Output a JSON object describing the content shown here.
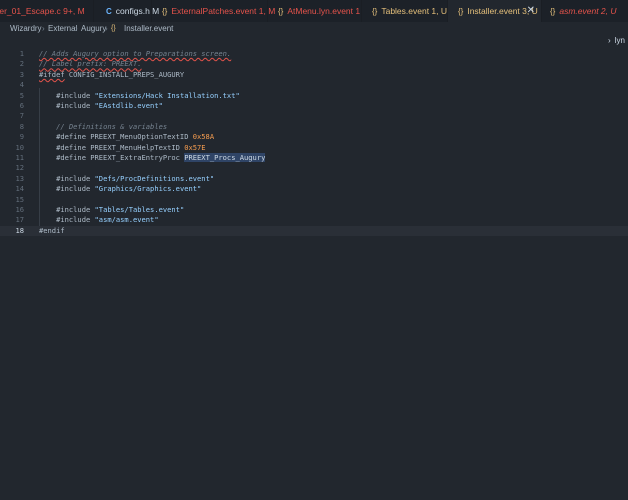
{
  "tabs": [
    {
      "label": "ter_01_Escape.c 9+, M",
      "icon": "",
      "color": "#e5534b",
      "active": false
    },
    {
      "label": "configs.h M",
      "icon": "C",
      "color": "#cdd9e5",
      "active": false
    },
    {
      "label": "ExternalPatches.event 1, M",
      "icon": "{}",
      "color": "#e5534b",
      "active": false
    },
    {
      "label": "AtMenu.lyn.event 1",
      "icon": "{}",
      "color": "#e5534b",
      "active": false
    },
    {
      "label": "Tables.event 1, U",
      "icon": "{}",
      "color": "#e5c07b",
      "active": false
    },
    {
      "label": "Installer.event 3, U",
      "icon": "{}",
      "color": "#e5c07b",
      "active": true
    },
    {
      "label": "asm.event 2, U",
      "icon": "{}",
      "color": "#e5534b",
      "active": false
    }
  ],
  "breadcrumbs": [
    "Wizardry",
    "External",
    "Augury",
    "Installer.event"
  ],
  "peek_label": "lyn",
  "colors": {
    "accent": "#2f4466",
    "error": "#e5534b",
    "string": "#96d0ff",
    "number": "#f69d50"
  },
  "editor": {
    "current_line": 18,
    "lines": [
      {
        "n": "1",
        "text": "// Adds Augury option to Preparations screen."
      },
      {
        "n": "2",
        "text": "// Label prefix: PREEXT."
      },
      {
        "n": "3",
        "text": "#ifdef CONFIG_INSTALL_PREPS_AUGURY"
      },
      {
        "n": "4",
        "text": ""
      },
      {
        "n": "5",
        "text": "    #include \"Extensions/Hack Installation.txt\""
      },
      {
        "n": "6",
        "text": "    #include \"EAstdlib.event\""
      },
      {
        "n": "7",
        "text": ""
      },
      {
        "n": "8",
        "text": "    // Definitions & variables"
      },
      {
        "n": "9",
        "text": "    #define PREEXT_MenuOptionTextID 0x58A"
      },
      {
        "n": "10",
        "text": "    #define PREEXT_MenuHelpTextID 0x57E"
      },
      {
        "n": "11",
        "text": "    #define PREEXT_ExtraEntryProc PREEXT_Procs_Augury"
      },
      {
        "n": "12",
        "text": ""
      },
      {
        "n": "13",
        "text": "    #include \"Defs/ProcDefinitions.event\""
      },
      {
        "n": "14",
        "text": "    #include \"Graphics/Graphics.event\""
      },
      {
        "n": "15",
        "text": ""
      },
      {
        "n": "16",
        "text": "    #include \"Tables/Tables.event\""
      },
      {
        "n": "17",
        "text": "    #include \"asm/asm.event\""
      },
      {
        "n": "18",
        "text": "#endif"
      }
    ]
  }
}
